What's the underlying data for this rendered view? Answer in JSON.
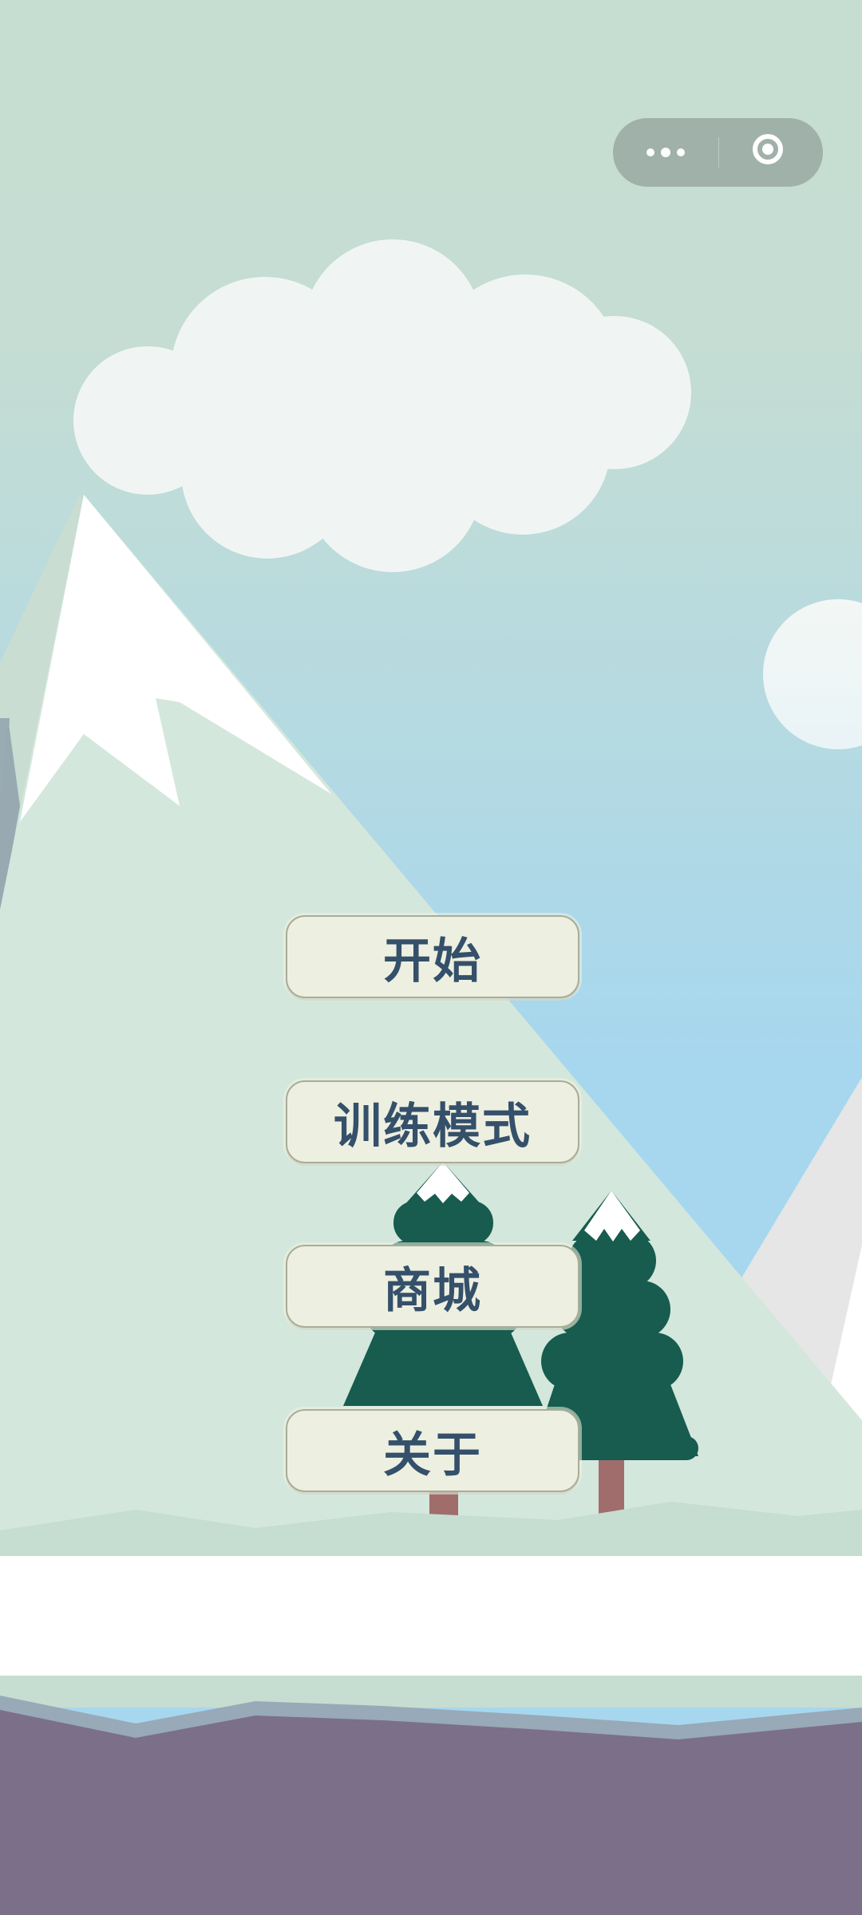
{
  "menu": {
    "start_label": "开始",
    "training_label": "训练模式",
    "shop_label": "商城",
    "about_label": "关于"
  },
  "capsule": {
    "more_icon": "more-dots-icon",
    "close_icon": "close-target-icon"
  },
  "colors": {
    "sky_top": "#c6ddd2",
    "sky_bottom": "#a8d8ee",
    "mountain": "#d4e7dc",
    "snow": "#ffffff",
    "tree": "#175c4e",
    "trunk": "#a06d6c",
    "snow_band": "#ffffff",
    "ground": "#7b6f89",
    "button_bg": "#edefe0",
    "button_text": "#34506a"
  }
}
